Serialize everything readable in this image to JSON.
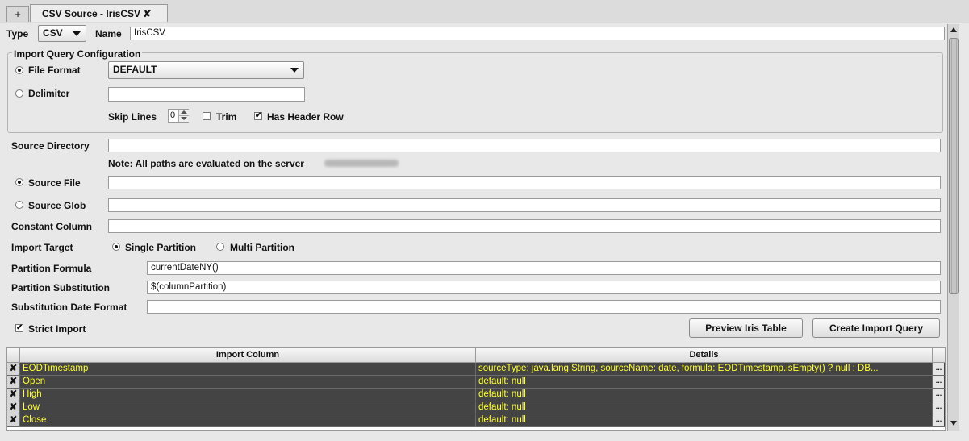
{
  "tabs": {
    "add_label": "+",
    "source_tab_label": "CSV Source - IrisCSV ✘"
  },
  "type": {
    "label": "Type",
    "value": "CSV"
  },
  "name": {
    "label": "Name",
    "value": "IrisCSV"
  },
  "import_query": {
    "group_title": "Import Query Configuration",
    "file_format_label": "File Format",
    "file_format_value": "DEFAULT",
    "delimiter_label": "Delimiter",
    "delimiter_value": "",
    "skip_lines_label": "Skip Lines",
    "skip_lines_value": "0",
    "trim_label": "Trim",
    "trim_checked": false,
    "has_header_label": "Has Header Row",
    "has_header_checked": true,
    "file_format_selected": true
  },
  "source_directory": {
    "label": "Source Directory",
    "value": ""
  },
  "note": {
    "text": "Note: All paths are evaluated on the server"
  },
  "source_file": {
    "label": "Source File",
    "value": "",
    "selected": true
  },
  "source_glob": {
    "label": "Source Glob",
    "value": "",
    "selected": false
  },
  "constant_column": {
    "label": "Constant Column",
    "value": ""
  },
  "import_target": {
    "label": "Import Target",
    "single_label": "Single Partition",
    "multi_label": "Multi Partition",
    "selected": "single"
  },
  "partition_formula": {
    "label": "Partition Formula",
    "value": "currentDateNY()"
  },
  "partition_substitution": {
    "label": "Partition Substitution",
    "value": "$(columnPartition)"
  },
  "substitution_date_format": {
    "label": "Substitution Date Format",
    "value": ""
  },
  "strict_import": {
    "label": "Strict Import",
    "checked": true
  },
  "buttons": {
    "preview": "Preview Iris Table",
    "create": "Create Import Query"
  },
  "table": {
    "headers": [
      "Import Column",
      "Details"
    ],
    "rows": [
      {
        "column": "EODTimestamp",
        "details": "sourceType: java.lang.String, sourceName: date, formula: EODTimestamp.isEmpty() ? null : DB..."
      },
      {
        "column": "Open",
        "details": "default: null"
      },
      {
        "column": "High",
        "details": "default: null"
      },
      {
        "column": "Low",
        "details": "default: null"
      },
      {
        "column": "Close",
        "details": "default: null"
      }
    ],
    "remove_glyph": "✘",
    "more_glyph": "..."
  },
  "colors": {
    "row_bg": "#444444",
    "row_text": "#ffff33"
  }
}
